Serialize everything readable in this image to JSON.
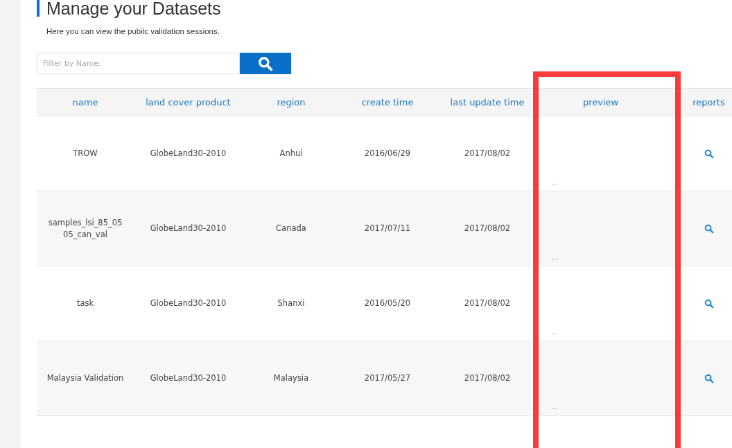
{
  "page": {
    "title": "Manage your Datasets",
    "subtitle": "Here you can view the pubilc validation sessions."
  },
  "filter": {
    "placeholder": "Filter by Name:"
  },
  "table": {
    "columns": [
      "name",
      "land cover product",
      "region",
      "create time",
      "last update time",
      "preview",
      "reports"
    ],
    "rows": [
      {
        "name": "TROW",
        "product": "GlobeLand30-2010",
        "region": "Anhui",
        "created": "2016/06/29",
        "updated": "2017/08/02",
        "preview": "..."
      },
      {
        "name": "samples_lsi_85_05 05_can_val",
        "product": "GlobeLand30-2010",
        "region": "Canada",
        "created": "2017/07/11",
        "updated": "2017/08/02",
        "preview": "..."
      },
      {
        "name": "task",
        "product": "GlobeLand30-2010",
        "region": "Shanxi",
        "created": "2016/05/20",
        "updated": "2017/08/02",
        "preview": "..."
      },
      {
        "name": "Malaysia Validation",
        "product": "GlobeLand30-2010",
        "region": "Malaysia",
        "created": "2017/05/27",
        "updated": "2017/08/02",
        "preview": "..."
      }
    ]
  },
  "highlight": {
    "kind": "rectangle"
  }
}
